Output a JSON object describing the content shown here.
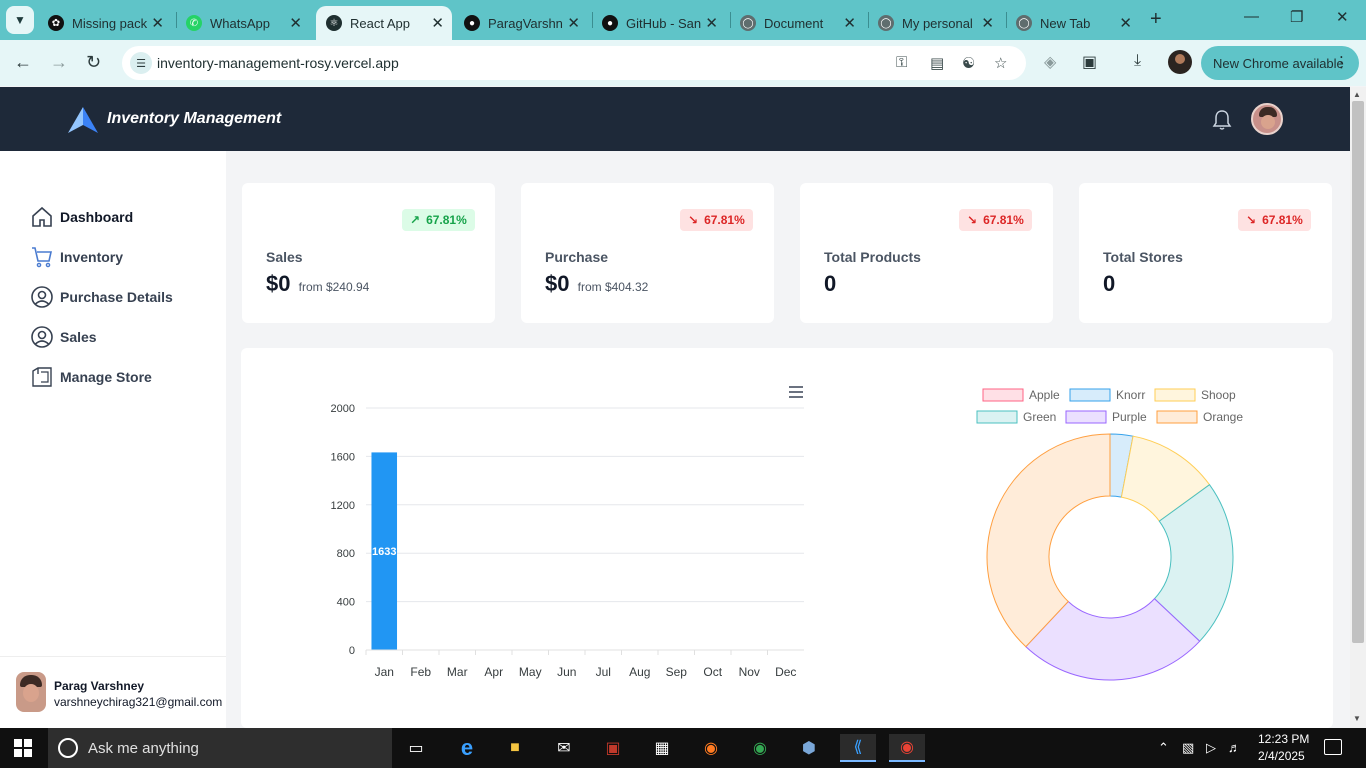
{
  "browser": {
    "tabs": [
      {
        "label": "Missing pack",
        "icon": "openai-icon",
        "active": false
      },
      {
        "label": "WhatsApp",
        "icon": "whatsapp-icon",
        "active": false
      },
      {
        "label": "React App",
        "icon": "react-icon",
        "active": true
      },
      {
        "label": "ParagVarshn",
        "icon": "github-icon",
        "active": false
      },
      {
        "label": "GitHub - San",
        "icon": "github-icon",
        "active": false
      },
      {
        "label": "Document",
        "icon": "globe-icon",
        "active": false
      },
      {
        "label": "My personal",
        "icon": "globe-icon",
        "active": false
      },
      {
        "label": "New Tab",
        "icon": "chrome-icon",
        "active": false
      }
    ],
    "url": "inventory-management-rosy.vercel.app",
    "update_label": "New Chrome available",
    "colors": {
      "frame": "#5fc4c8",
      "toolbar": "#e6f6f7"
    }
  },
  "app": {
    "title": "Inventory Management",
    "colors": {
      "header": "#1e2939",
      "accent_blue": "#2196f3"
    }
  },
  "sidebar": {
    "items": [
      {
        "label": "Dashboard",
        "icon": "home-icon"
      },
      {
        "label": "Inventory",
        "icon": "cart-icon"
      },
      {
        "label": "Purchase Details",
        "icon": "user-circle-icon"
      },
      {
        "label": "Sales",
        "icon": "user-circle-icon"
      },
      {
        "label": "Manage Store",
        "icon": "store-icon"
      }
    ],
    "user": {
      "name": "Parag Varshney",
      "email": "varshneychirag321@gmail.com"
    }
  },
  "stats": [
    {
      "label": "Sales",
      "value": "$0",
      "from": "from $240.94",
      "badge": "67.81%",
      "trend": "up"
    },
    {
      "label": "Purchase",
      "value": "$0",
      "from": "from $404.32",
      "badge": "67.81%",
      "trend": "down"
    },
    {
      "label": "Total Products",
      "value": "0",
      "from": "",
      "badge": "67.81%",
      "trend": "down"
    },
    {
      "label": "Total Stores",
      "value": "0",
      "from": "",
      "badge": "67.81%",
      "trend": "down"
    }
  ],
  "chart_data": [
    {
      "type": "bar",
      "categories": [
        "Jan",
        "Feb",
        "Mar",
        "Apr",
        "May",
        "Jun",
        "Jul",
        "Aug",
        "Sep",
        "Oct",
        "Nov",
        "Dec"
      ],
      "series": [
        {
          "values": [
            1633,
            0,
            0,
            0,
            0,
            0,
            0,
            0,
            0,
            0,
            0,
            0
          ]
        }
      ],
      "data_labels": [
        "1633"
      ],
      "yticks": [
        "0",
        "400",
        "800",
        "1200",
        "1600",
        "2000"
      ],
      "ylim": [
        0,
        2000
      ],
      "grid": true,
      "color": "#2196f3"
    },
    {
      "type": "pie",
      "donut": true,
      "legend_position": "top",
      "labels": [
        "Apple",
        "Knorr",
        "Shoop",
        "Green",
        "Purple",
        "Orange"
      ],
      "values": [
        0,
        3,
        12,
        22,
        25,
        38
      ],
      "border_colors": [
        "#ff6384",
        "#36a2eb",
        "#ffce56",
        "#4bc0c0",
        "#9966ff",
        "#ff9f40"
      ],
      "fill_colors": [
        "#ffe0e6",
        "#d7ecfb",
        "#fff5dd",
        "#dbf2f2",
        "#ebe0ff",
        "#ffecd9"
      ]
    }
  ],
  "taskbar": {
    "search_placeholder": "Ask me anything",
    "time": "12:23 PM",
    "date": "2/4/2025"
  }
}
